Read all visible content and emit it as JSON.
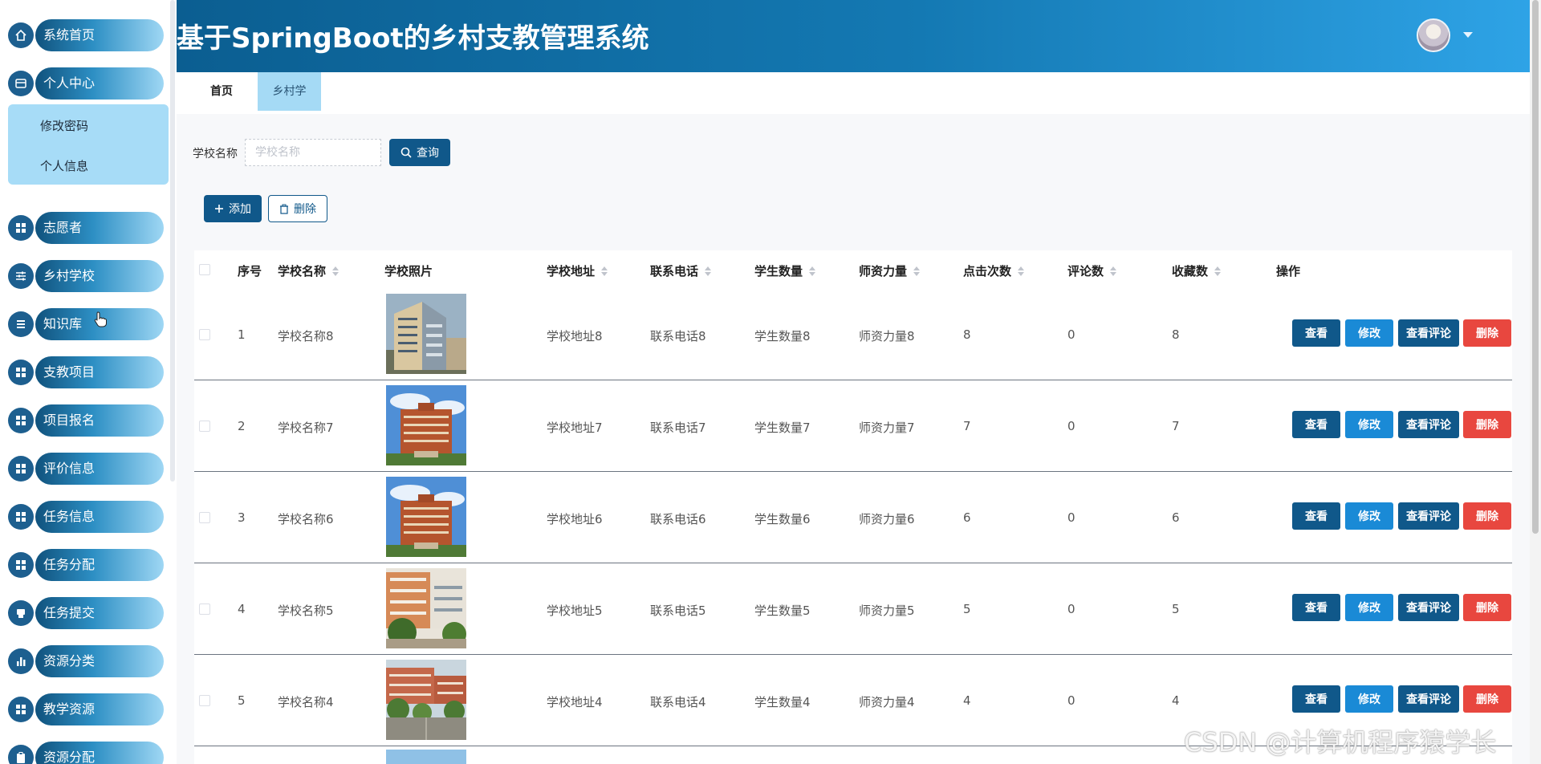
{
  "app_title": "基于SpringBoot的乡村支教管理系统",
  "sidebar": {
    "items": [
      {
        "label": "系统首页",
        "icon": "home-icon"
      },
      {
        "label": "个人中心",
        "icon": "wallet-icon"
      },
      {
        "label": "志愿者",
        "icon": "grid-icon"
      },
      {
        "label": "乡村学校",
        "icon": "sliders-icon"
      },
      {
        "label": "知识库",
        "icon": "list-icon"
      },
      {
        "label": "支教项目",
        "icon": "grid-icon"
      },
      {
        "label": "项目报名",
        "icon": "grid-icon"
      },
      {
        "label": "评价信息",
        "icon": "grid-icon"
      },
      {
        "label": "任务信息",
        "icon": "grid-icon"
      },
      {
        "label": "任务分配",
        "icon": "grid-icon"
      },
      {
        "label": "任务提交",
        "icon": "printer-icon"
      },
      {
        "label": "资源分类",
        "icon": "bar-chart-icon"
      },
      {
        "label": "教学资源",
        "icon": "grid-icon"
      },
      {
        "label": "资源分配",
        "icon": "clipboard-icon"
      }
    ],
    "submenu": [
      "修改密码",
      "个人信息"
    ]
  },
  "tabs": {
    "home": "首页",
    "school": "乡村学校"
  },
  "search": {
    "label": "学校名称",
    "placeholder": "学校名称",
    "query_button": "查询"
  },
  "toolbar": {
    "add": "添加",
    "delete": "删除"
  },
  "table": {
    "headers": {
      "index": "序号",
      "name": "学校名称",
      "photo": "学校照片",
      "address": "学校地址",
      "phone": "联系电话",
      "students": "学生数量",
      "teachers": "师资力量",
      "clicks": "点击次数",
      "comments": "评论数",
      "favorites": "收藏数",
      "actions": "操作"
    },
    "row_buttons": {
      "view": "查看",
      "edit": "修改",
      "comments": "查看评论",
      "delete": "删除"
    },
    "rows": [
      {
        "index": "1",
        "name": "学校名称8",
        "address": "学校地址8",
        "phone": "联系电话8",
        "students": "学生数量8",
        "teachers": "师资力量8",
        "clicks": "8",
        "comments": "0",
        "favorites": "8"
      },
      {
        "index": "2",
        "name": "学校名称7",
        "address": "学校地址7",
        "phone": "联系电话7",
        "students": "学生数量7",
        "teachers": "师资力量7",
        "clicks": "7",
        "comments": "0",
        "favorites": "7"
      },
      {
        "index": "3",
        "name": "学校名称6",
        "address": "学校地址6",
        "phone": "联系电话6",
        "students": "学生数量6",
        "teachers": "师资力量6",
        "clicks": "6",
        "comments": "0",
        "favorites": "6"
      },
      {
        "index": "4",
        "name": "学校名称5",
        "address": "学校地址5",
        "phone": "联系电话5",
        "students": "学生数量5",
        "teachers": "师资力量5",
        "clicks": "5",
        "comments": "0",
        "favorites": "5"
      },
      {
        "index": "5",
        "name": "学校名称4",
        "address": "学校地址4",
        "phone": "联系电话4",
        "students": "学生数量4",
        "teachers": "师资力量4",
        "clicks": "4",
        "comments": "0",
        "favorites": "4"
      }
    ]
  },
  "watermark": "CSDN @计算机程序猿学长",
  "colors": {
    "primary": "#10588a",
    "header_start": "#0b5e91",
    "header_end": "#2ea3e6",
    "danger": "#e8473f",
    "edit": "#1a8ad6",
    "tab_active": "#a5daf5"
  }
}
